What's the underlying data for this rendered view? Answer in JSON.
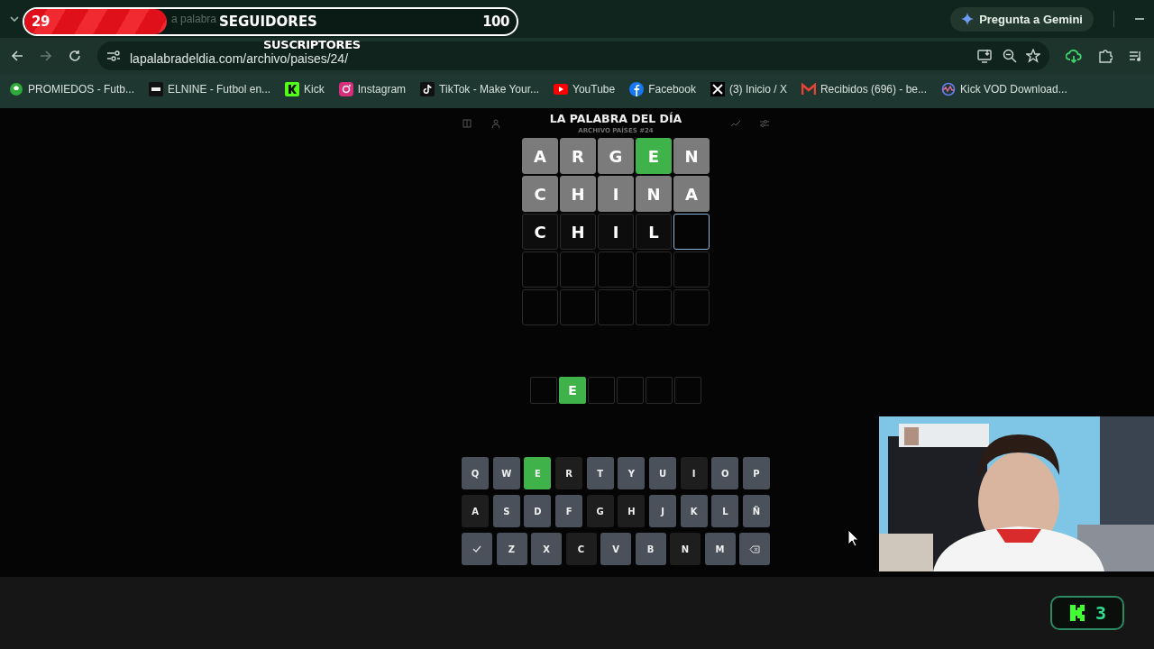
{
  "browser": {
    "tab_title": "a palabra",
    "gemini_button": "Pregunta a Gemini",
    "url": "lapalabradeldia.com/archivo/paises/24/",
    "bookmarks": [
      {
        "label": "PROMIEDOS - Futb..."
      },
      {
        "label": "ELNINE - Futbol en..."
      },
      {
        "label": "Kick"
      },
      {
        "label": "Instagram"
      },
      {
        "label": "TikTok - Make Your..."
      },
      {
        "label": "YouTube"
      },
      {
        "label": "Facebook"
      },
      {
        "label": "(3) Inicio / X"
      },
      {
        "label": "Recibidos (696) - be..."
      },
      {
        "label": "Kick VOD Download..."
      }
    ]
  },
  "game": {
    "title": "LA PALABRA DEL DÍA",
    "subtitle": "ARCHIVO PAÍSES #24",
    "board": [
      [
        {
          "letter": "A",
          "correct": false,
          "absent": true,
          "active": false
        },
        {
          "letter": "R",
          "correct": false,
          "absent": true,
          "active": false
        },
        {
          "letter": "G",
          "correct": false,
          "absent": true,
          "active": false
        },
        {
          "letter": "E",
          "correct": true,
          "absent": false,
          "active": false
        },
        {
          "letter": "N",
          "correct": false,
          "absent": true,
          "active": false
        }
      ],
      [
        {
          "letter": "C",
          "correct": false,
          "absent": true,
          "active": false
        },
        {
          "letter": "H",
          "correct": false,
          "absent": true,
          "active": false
        },
        {
          "letter": "I",
          "correct": false,
          "absent": true,
          "active": false
        },
        {
          "letter": "N",
          "correct": false,
          "absent": true,
          "active": false
        },
        {
          "letter": "A",
          "correct": false,
          "absent": true,
          "active": false
        }
      ],
      [
        {
          "letter": "C",
          "correct": false,
          "absent": false,
          "active": false
        },
        {
          "letter": "H",
          "correct": false,
          "absent": false,
          "active": false
        },
        {
          "letter": "I",
          "correct": false,
          "absent": false,
          "active": false
        },
        {
          "letter": "L",
          "correct": false,
          "absent": false,
          "active": false
        },
        {
          "correct": false,
          "absent": false,
          "active": true
        }
      ],
      [
        {
          "correct": false,
          "absent": false,
          "active": false
        },
        {
          "correct": false,
          "absent": false,
          "active": false
        },
        {
          "correct": false,
          "absent": false,
          "active": false
        },
        {
          "correct": false,
          "absent": false,
          "active": false
        },
        {
          "correct": false,
          "absent": false,
          "active": false
        }
      ],
      [
        {
          "correct": false,
          "absent": false,
          "active": false
        },
        {
          "correct": false,
          "absent": false,
          "active": false
        },
        {
          "correct": false,
          "absent": false,
          "active": false
        },
        {
          "correct": false,
          "absent": false,
          "active": false
        },
        {
          "correct": false,
          "absent": false,
          "active": false
        }
      ]
    ],
    "answer": [
      {
        "correct": false
      },
      {
        "letter": "E",
        "correct": true
      },
      {
        "correct": false
      },
      {
        "correct": false
      },
      {
        "correct": false
      },
      {
        "correct": false
      }
    ],
    "keyboard": [
      [
        {
          "kind": "letter",
          "label": "Q",
          "correct": false,
          "absent": false
        },
        {
          "kind": "letter",
          "label": "W",
          "correct": false,
          "absent": false
        },
        {
          "kind": "letter",
          "label": "E",
          "correct": true,
          "absent": false
        },
        {
          "kind": "letter",
          "label": "R",
          "correct": false,
          "absent": true
        },
        {
          "kind": "letter",
          "label": "T",
          "correct": false,
          "absent": false
        },
        {
          "kind": "letter",
          "label": "Y",
          "correct": false,
          "absent": false
        },
        {
          "kind": "letter",
          "label": "U",
          "correct": false,
          "absent": false
        },
        {
          "kind": "letter",
          "label": "I",
          "correct": false,
          "absent": true
        },
        {
          "kind": "letter",
          "label": "O",
          "correct": false,
          "absent": false
        },
        {
          "kind": "letter",
          "label": "P",
          "correct": false,
          "absent": false
        }
      ],
      [
        {
          "kind": "letter",
          "label": "A",
          "correct": false,
          "absent": true
        },
        {
          "kind": "letter",
          "label": "S",
          "correct": false,
          "absent": false
        },
        {
          "kind": "letter",
          "label": "D",
          "correct": false,
          "absent": false
        },
        {
          "kind": "letter",
          "label": "F",
          "correct": false,
          "absent": false
        },
        {
          "kind": "letter",
          "label": "G",
          "correct": false,
          "absent": true
        },
        {
          "kind": "letter",
          "label": "H",
          "correct": false,
          "absent": true
        },
        {
          "kind": "letter",
          "label": "J",
          "correct": false,
          "absent": false
        },
        {
          "kind": "letter",
          "label": "K",
          "correct": false,
          "absent": false
        },
        {
          "kind": "letter",
          "label": "L",
          "correct": false,
          "absent": false
        },
        {
          "kind": "letter",
          "label": "Ñ",
          "correct": false,
          "absent": false
        }
      ],
      [
        {
          "kind": "enter",
          "correct": false,
          "absent": false
        },
        {
          "kind": "letter",
          "label": "Z",
          "correct": false,
          "absent": false
        },
        {
          "kind": "letter",
          "label": "X",
          "correct": false,
          "absent": false
        },
        {
          "kind": "letter",
          "label": "C",
          "correct": false,
          "absent": true
        },
        {
          "kind": "letter",
          "label": "V",
          "correct": false,
          "absent": false
        },
        {
          "kind": "letter",
          "label": "B",
          "correct": false,
          "absent": false
        },
        {
          "kind": "letter",
          "label": "N",
          "correct": false,
          "absent": true
        },
        {
          "kind": "letter",
          "label": "M",
          "correct": false,
          "absent": false
        },
        {
          "kind": "backspace",
          "correct": false,
          "absent": false
        }
      ]
    ]
  },
  "overlay": {
    "follower_goal": {
      "current": "29",
      "label": "SEGUIDORES",
      "target": "100",
      "level": 0.29
    },
    "subscriber_label": "SUSCRIPTORES",
    "kick_counter": "3"
  }
}
